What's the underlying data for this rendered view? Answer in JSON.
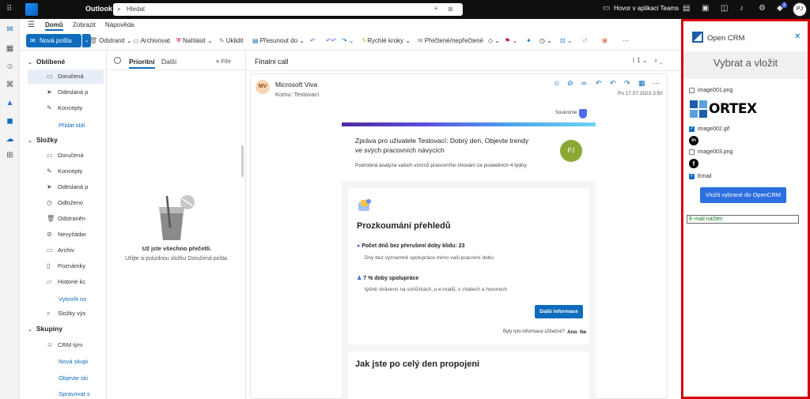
{
  "topbar": {
    "app_name": "Outlook",
    "search_placeholder": "Hledat",
    "teams_call": "Hovor v aplikaci Teams",
    "notification_count": "1",
    "avatar_initials": "PJ"
  },
  "menubar": {
    "tabs": [
      "Domů",
      "Zobrazit",
      "Nápověda"
    ]
  },
  "ribbon": {
    "new_mail": "Nová pošta",
    "delete": "Odstranit",
    "archive": "Archivovat",
    "report": "Nahlásit",
    "sweep": "Uklidit",
    "move_to": "Přesunout do",
    "quick_steps": "Rychlé kroky",
    "read_unread": "Přečtené/nepřečtené"
  },
  "folders": {
    "favorites_header": "Oblíbené",
    "favorites": [
      "Doručená",
      "Odeslaná p",
      "Koncepty"
    ],
    "add_favorite": "Přidat oblí",
    "folders_header": "Složky",
    "folder_items": [
      "Doručená",
      "Koncepty",
      "Odeslaná p",
      "Odloženo",
      "Odstraněn",
      "Nevyžádar",
      "Archiv",
      "Poznámky",
      "Historie kc"
    ],
    "create_new": "Vytvořit no",
    "search_folders": "Složky výs",
    "groups_header": "Skupiny",
    "group_items": [
      "CRM tým"
    ],
    "new_group": "Nová skupi",
    "discover_groups": "Objevte ski",
    "manage_groups": "Spravovat s"
  },
  "msglist": {
    "tab_focused": "Prioritní",
    "tab_other": "Další",
    "filter": "Filtr",
    "empty_title": "Už jste všechno přečetli.",
    "empty_sub": "Užijte si prázdnou složku Doručená pošta."
  },
  "reading": {
    "subject": "Finalni call",
    "attach_count": "1",
    "sender_initials": "MV",
    "sender": "Microsoft Viva",
    "to": "Komu:  Testovací",
    "date": "Po 17.07.2023 3:50"
  },
  "email": {
    "private": "Soukromé",
    "headline": "Zpráva pro uživatele Testovací: Dobrý den, Objevte trendy ve svých pracovních návycích",
    "pj": "PJ",
    "desc": "Podrobná analýza vašich vzorců pracovního chování za posledních 4 týdny",
    "section_title": "Prozkoumání přehledů",
    "stat1": "Počet dnů bez přerušení doby klidu: 23",
    "stat1_desc": "Dny bez významné spolupráce mimo vaši pracovní dobu",
    "stat2": "7 % doby spolupráce",
    "stat2_desc": "týdně stráveno na schůzkách, u e-mailů, v chatech a hovorech",
    "more_button": "Další informace",
    "useful_q": "Byly tyto informace užitečné?",
    "yes": "Ano",
    "no": "Ne",
    "section2_title": "Jak jste po celý den propojeni"
  },
  "crm": {
    "title": "Open CRM",
    "subtitle": "Vybrat a vložit",
    "items": [
      {
        "label": "image001.png",
        "checked": false
      },
      {
        "label": "image002.gif",
        "checked": true
      },
      {
        "label": "image003.png",
        "checked": false
      },
      {
        "label": "Email",
        "checked": true
      }
    ],
    "ortex_logo_text": "ORTEX",
    "linkedin_glyph": "in",
    "facebook_glyph": "f",
    "send_button": "Vložit vybrané do OpenCRM",
    "status": "E-mail načten"
  },
  "colors": {
    "accent": "#0f6cbd",
    "highlight_border": "#d40000",
    "status_text": "#107c10"
  }
}
